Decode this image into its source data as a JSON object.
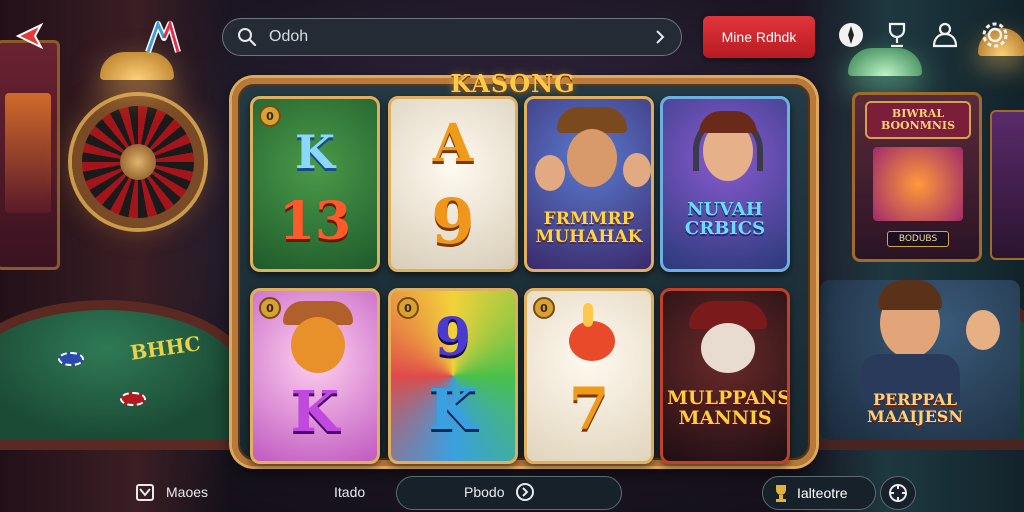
{
  "header": {
    "search_text": "Odoh",
    "cta_label": "Mine Rdhdk"
  },
  "panel": {
    "title": "KASONG"
  },
  "cards": [
    {
      "badge": "0",
      "top_text": "K",
      "bottom_text": "13",
      "caption": ""
    },
    {
      "badge": "",
      "top_text": "A",
      "bottom_text": "9",
      "caption": ""
    },
    {
      "badge": "",
      "top_text": "",
      "bottom_text": "",
      "caption": "FRMMRP MUHAHAK"
    },
    {
      "badge": "",
      "top_text": "",
      "bottom_text": "",
      "caption": "NUVAH CRBICS"
    },
    {
      "badge": "0",
      "top_text": "",
      "bottom_text": "K",
      "caption": ""
    },
    {
      "badge": "0",
      "top_text": "9",
      "bottom_text": "K",
      "caption": ""
    },
    {
      "badge": "0",
      "top_text": "",
      "bottom_text": "7",
      "caption": ""
    },
    {
      "badge": "",
      "top_text": "",
      "bottom_text": "",
      "caption": "MULPPANS MANNIS"
    }
  ],
  "background": {
    "arcade_sign": "BIWRAL BOONMNIS",
    "bonus_label": "BODUBS",
    "right_poster": "PERPPAL MAAIJESN",
    "table_text": "BHHC"
  },
  "bottom_bar": {
    "left_label": "Maoes",
    "mid_label": "Itado",
    "pill_label": "Pbodo",
    "right_label": "Ialteotre"
  },
  "colors": {
    "accent_gold": "#e0b060",
    "cta_red": "#d02a30",
    "panel_bg": "#1f3440"
  }
}
